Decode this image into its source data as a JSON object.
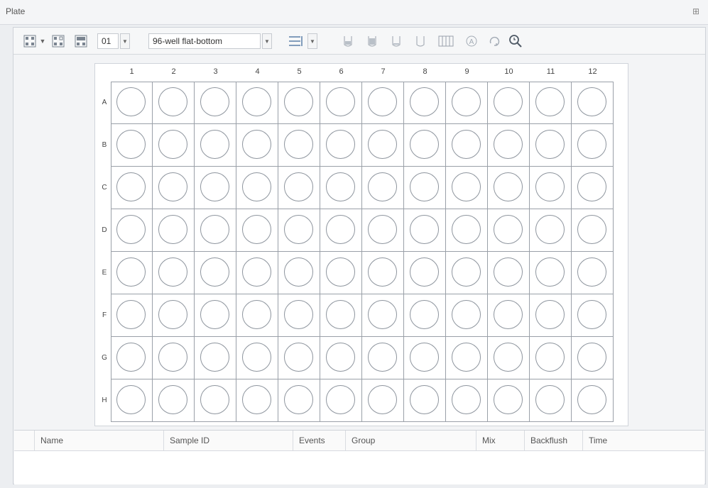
{
  "panel": {
    "title": "Plate"
  },
  "toolbar": {
    "plate_number": "01",
    "plate_type": "96-well flat-bottom"
  },
  "plate": {
    "columns": [
      "1",
      "2",
      "3",
      "4",
      "5",
      "6",
      "7",
      "8",
      "9",
      "10",
      "11",
      "12"
    ],
    "rows": [
      "A",
      "B",
      "C",
      "D",
      "E",
      "F",
      "G",
      "H"
    ]
  },
  "table": {
    "headers": [
      "Name",
      "Sample ID",
      "Events",
      "Group",
      "Mix",
      "Backflush",
      "Time"
    ]
  },
  "icons": {
    "pin": "pin-icon",
    "tools": [
      "grid-layout-icon",
      "grid-select-icon",
      "grid-fill-icon",
      "list-order-icon",
      "tube-icon",
      "tube-fill-icon",
      "tube-empty-icon",
      "tube-outline-icon",
      "rack-icon",
      "letter-a-icon",
      "rotate-icon",
      "search-zoom-icon"
    ]
  }
}
